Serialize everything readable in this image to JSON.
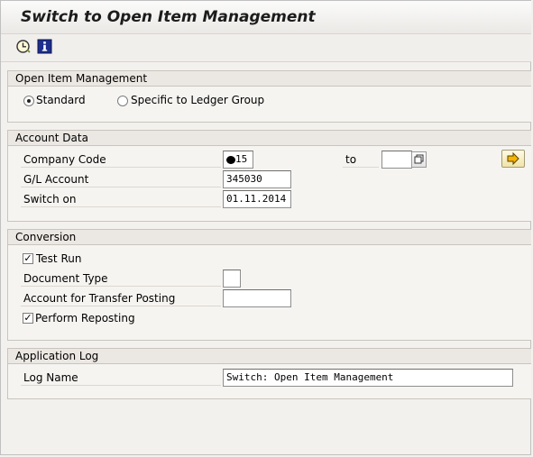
{
  "window": {
    "title": "Switch to Open Item Management"
  },
  "toolbar": {
    "icons": [
      "execute-clock-icon",
      "information-icon"
    ]
  },
  "open_item_management": {
    "heading": "Open Item Management",
    "options": [
      {
        "label": "Standard",
        "selected": true
      },
      {
        "label": "Specific to Ledger Group",
        "selected": false
      }
    ]
  },
  "account_data": {
    "heading": "Account Data",
    "company_code_label": "Company Code",
    "company_code_value": "15",
    "to_label": "to",
    "company_code_to_value": "",
    "gl_account_label": "G/L Account",
    "gl_account_value": "345030",
    "switch_on_label": "Switch on",
    "switch_on_value": "01.11.2014"
  },
  "conversion": {
    "heading": "Conversion",
    "test_run_label": "Test Run",
    "test_run_checked": true,
    "document_type_label": "Document Type",
    "document_type_value": "",
    "transfer_account_label": "Account for Transfer Posting",
    "transfer_account_value": "",
    "perform_reposting_label": "Perform Reposting",
    "perform_reposting_checked": true
  },
  "application_log": {
    "heading": "Application Log",
    "log_name_label": "Log Name",
    "log_name_value": "Switch: Open Item Management"
  },
  "glyphs": {
    "check": "✓"
  }
}
